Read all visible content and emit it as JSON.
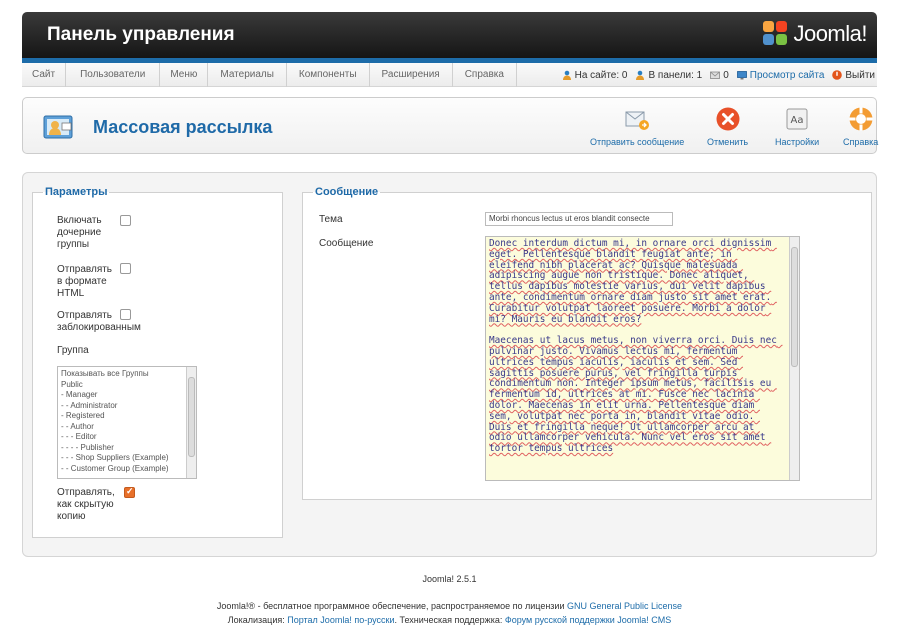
{
  "header": {
    "title": "Панель управления",
    "logo_text": "Joomla!"
  },
  "menu": {
    "items": [
      "Сайт",
      "Пользователи",
      "Меню",
      "Материалы",
      "Компоненты",
      "Расширения",
      "Справка"
    ],
    "status": {
      "on_site": "На сайте: 0",
      "in_panel": "В панели: 1",
      "messages": "0",
      "view_site": "Просмотр сайта",
      "logout": "Выйти"
    }
  },
  "toolbar": {
    "title": "Массовая рассылка",
    "send": "Отправить сообщение",
    "cancel": "Отменить",
    "settings": "Настройки",
    "help": "Справка"
  },
  "params": {
    "legend": "Параметры",
    "include_children": [
      "Включать",
      "дочерние",
      "группы"
    ],
    "send_html": [
      "Отправлять",
      "в формате",
      "HTML"
    ],
    "send_blocked": [
      "Отправлять",
      "заблокированным"
    ],
    "group_label": "Группа",
    "groups": [
      "Показывать все Группы",
      "Public",
      "- Manager",
      "- - Administrator",
      "- Registered",
      "- - Author",
      "- - - Editor",
      "- - - - Publisher",
      "- - - Shop Suppliers (Example)",
      "- - Customer Group (Example)"
    ],
    "send_bcc": [
      "Отправлять,",
      "как скрытую",
      "копию"
    ]
  },
  "message": {
    "legend": "Сообщение",
    "subject_label": "Тема",
    "subject_value": "Morbi rhoncus lectus ut eros blandit consecte",
    "message_label": "Сообщение",
    "body": "Donec interdum dictum mi, in ornare orci dignissim eget. Pellentesque blandit feugiat ante; in eleifend nibh placerat ac? Quisque malesuada adipiscing augue non tristique. Donec aliquet, tellus dapibus molestie varius, dui velit dapibus ante, condimentum ornare diam justo sit amet erat. Curabitur volutpat laoreet posuere. Morbi a dolor mi? Mauris eu blandit eros?\n\nMaecenas ut lacus metus, non viverra orci. Duis nec pulvinar justo. Vivamus lectus mi, fermentum ultrices tempus iaculis, iaculis et sem. Sed sagittis posuere purus, vel fringilla turpis condimentum non. Integer ipsum metus, facilisis eu fermentum id, ultrices at mi. Fusce nec lacinia dolor. Maecenas in elit urna. Pellentesque diam sem, volutpat nec porta in, blandit vitae odio. Duis et fringilla neque! Ut ullamcorper arcu at odio ullamcorper vehicula. Nunc vel eros sit amet tortor tempus ultrices"
  },
  "footer": {
    "version": "Joomla! 2.5.1",
    "line1_a": "Joomla!® - бесплатное программное обеспечение, распространяемое по лицензии",
    "line1_link": "GNU General Public License",
    "line2_a": "Локализация:",
    "line2_link1": "Портал Joomla! по-русски",
    "line2_b": ". Техническая поддержка:",
    "line2_link2": "Форум русской поддержки Joomla! CMS"
  }
}
